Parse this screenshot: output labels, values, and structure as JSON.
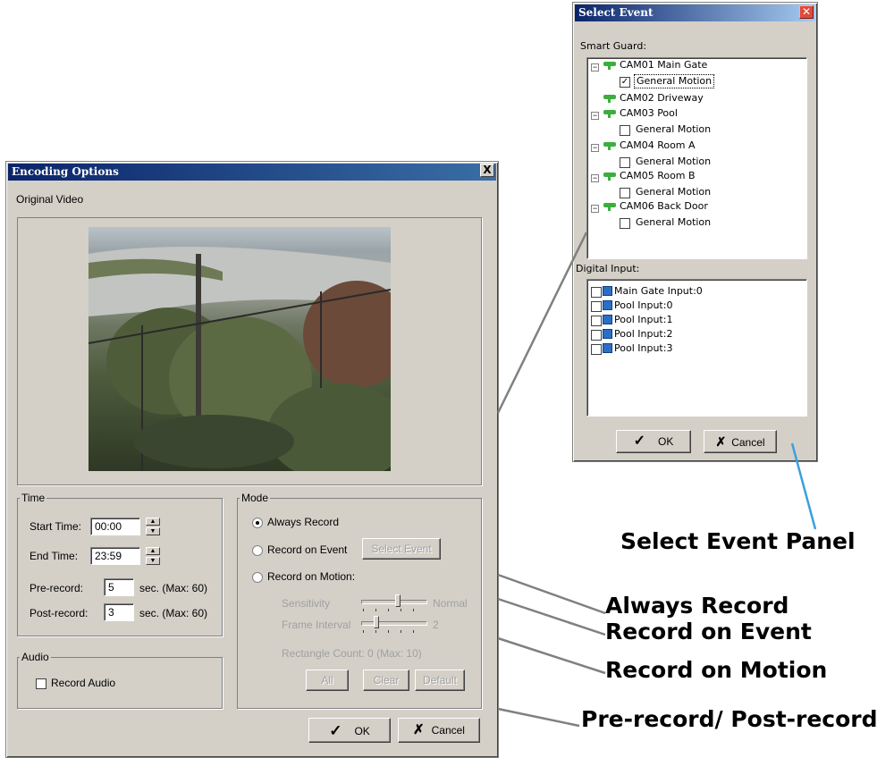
{
  "encoding": {
    "title": "Encoding Options",
    "close": "X",
    "original_video_label": "Original Video",
    "time": {
      "title": "Time",
      "start_label": "Start Time:",
      "start_value": "00:00",
      "end_label": "End Time:",
      "end_value": "23:59",
      "pre_label": "Pre-record:",
      "pre_value": "5",
      "pre_unit": "sec. (Max: 60)",
      "post_label": "Post-record:",
      "post_value": "3",
      "post_unit": "sec. (Max: 60)"
    },
    "audio": {
      "title": "Audio",
      "record_audio": "Record Audio",
      "checked": false
    },
    "mode": {
      "title": "Mode",
      "always_record": "Always Record",
      "record_on_event": "Record on Event",
      "select_event_btn": "Select Event",
      "record_on_motion": "Record on Motion:",
      "selected": "always_record",
      "sensitivity_label": "Sensitivity",
      "sensitivity_value": "Normal",
      "frame_interval_label": "Frame Interval",
      "frame_interval_value": "2",
      "rectangle_count": "Rectangle Count: 0  (Max: 10)",
      "all_btn": "All",
      "clear_btn": "Clear",
      "default_btn": "Default"
    },
    "ok": "OK",
    "cancel": "Cancel"
  },
  "select_event": {
    "title": "Select Event",
    "smart_guard_label": "Smart Guard:",
    "cameras": [
      {
        "name": "CAM01 Main Gate",
        "event": "General Motion",
        "checked": true
      },
      {
        "name": "CAM02 Driveway"
      },
      {
        "name": "CAM03 Pool",
        "event": "General Motion",
        "checked": false
      },
      {
        "name": "CAM04 Room A",
        "event": "General Motion",
        "checked": false
      },
      {
        "name": "CAM05 Room B",
        "event": "General Motion",
        "checked": false
      },
      {
        "name": "CAM06 Back Door",
        "event": "General Motion",
        "checked": false
      }
    ],
    "digital_input_label": "Digital Input:",
    "inputs": [
      "Main Gate Input:0",
      "Pool Input:0",
      "Pool Input:1",
      "Pool Input:2",
      "Pool Input:3"
    ],
    "ok": "OK",
    "cancel": "Cancel"
  },
  "callouts": {
    "select_event_panel": "Select Event Panel",
    "always_record": "Always Record",
    "record_on_event": "Record on Event",
    "record_on_motion": "Record on Motion",
    "pre_post_record": "Pre-record/ Post-record"
  },
  "colors": {
    "dialog_bg": "#d4d0c8",
    "titlebar_start": "#0a246a",
    "titlebar_end": "#3a6ea5",
    "callout_line": "#808080",
    "callout_line_blue": "#3aa0e0",
    "cam_icon": "#3cae3c"
  }
}
